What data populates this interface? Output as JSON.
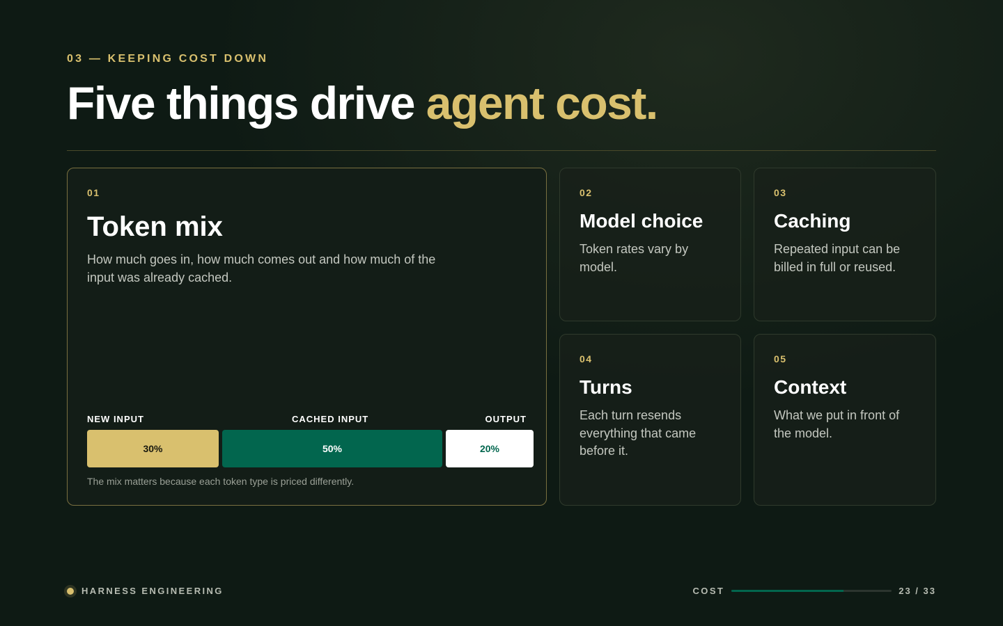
{
  "eyebrow": "03 — KEEPING COST DOWN",
  "headline": {
    "lead": "Five things drive ",
    "accent": "agent cost."
  },
  "cards": [
    {
      "num": "01",
      "title": "Token mix",
      "desc": "How much goes in, how much comes out and how much of the input was already cached.",
      "mix": [
        {
          "label": "NEW INPUT",
          "percent": "30%"
        },
        {
          "label": "CACHED INPUT",
          "percent": "50%"
        },
        {
          "label": "OUTPUT",
          "percent": "20%"
        }
      ],
      "footnote": "The mix matters because each token type is priced differently."
    },
    {
      "num": "02",
      "title": "Model choice",
      "desc": "Token rates vary by model."
    },
    {
      "num": "03",
      "title": "Caching",
      "desc": "Repeated input can be billed in full or reused."
    },
    {
      "num": "04",
      "title": "Turns",
      "desc": "Each turn resends everything that came before it."
    },
    {
      "num": "05",
      "title": "Context",
      "desc": "What we put in front of the model."
    }
  ],
  "footer": {
    "brand": "HARNESS ENGINEERING",
    "section": "COST",
    "page_current": 23,
    "page_total": 33,
    "page_label": "23 / 33",
    "progress_fraction": 0.697
  },
  "colors": {
    "accent": "#d9c06e",
    "green": "#02664e",
    "background": "#0e1a14"
  }
}
